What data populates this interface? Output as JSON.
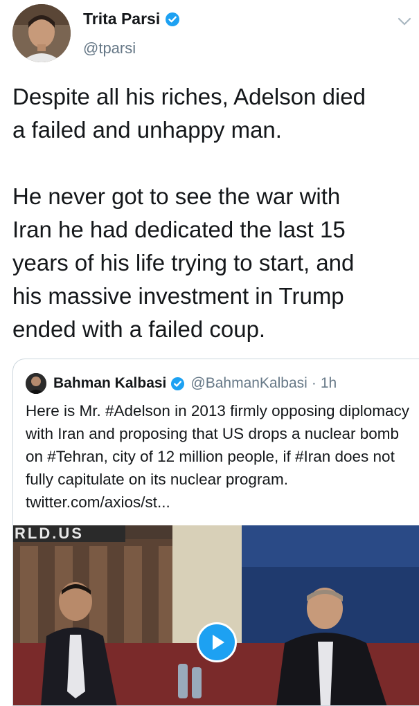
{
  "tweet": {
    "author_name": "Trita Parsi",
    "author_handle": "@tparsi",
    "text": "Despite all his riches, Adelson died\na failed and unhappy man.\n\nHe never got to see the war with\nIran he had dedicated the last 15\nyears of his life trying to start, and\nhis massive investment in Trump\nended with a failed coup."
  },
  "quoted_tweet": {
    "author_name": "Bahman Kalbasi",
    "author_handle": "@BahmanKalbasi",
    "separator": "·",
    "time": "1h",
    "text": "Here is Mr. #Adelson in 2013 firmly opposing diplomacy with Iran and proposing that US drops a nuclear bomb on #Tehran, city of 12 million people, if #Iran does not fully capitulate on its nuclear program. twitter.com/axios/st...",
    "media_watermark": "RLD.US"
  },
  "colors": {
    "accent": "#1da1f2",
    "text": "#14171a",
    "muted": "#657786",
    "border": "#ccd6dd"
  },
  "icons": [
    "verified-badge-icon",
    "chevron-down-icon",
    "play-icon"
  ]
}
